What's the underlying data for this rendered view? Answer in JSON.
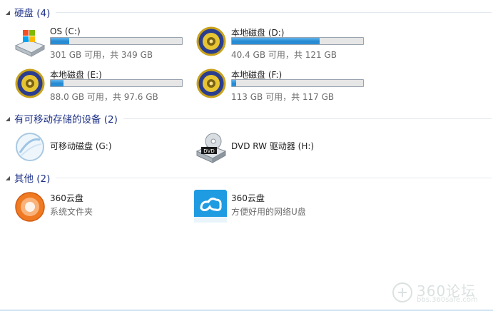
{
  "groups": [
    {
      "title": "硬盘 (4)",
      "items": [
        {
          "name": "OS (C:)",
          "usage": "301 GB 可用，共 349 GB",
          "used_fraction": 0.14,
          "icon": "windows-drive-icon"
        },
        {
          "name": "本地磁盘 (D:)",
          "usage": "40.4 GB 可用，共 121 GB",
          "used_fraction": 0.67,
          "icon": "local-disk-icon"
        },
        {
          "name": "本地磁盘 (E:)",
          "usage": "88.0 GB 可用，共 97.6 GB",
          "used_fraction": 0.1,
          "icon": "local-disk-icon"
        },
        {
          "name": "本地磁盘 (F:)",
          "usage": "113 GB 可用，共 117 GB",
          "used_fraction": 0.03,
          "icon": "local-disk-icon"
        }
      ]
    },
    {
      "title": "有可移动存储的设备 (2)",
      "items": [
        {
          "name": "可移动磁盘 (G:)",
          "icon": "removable-disk-icon"
        },
        {
          "name": "DVD RW 驱动器 (H:)",
          "icon": "dvd-drive-icon"
        }
      ]
    },
    {
      "title": "其他 (2)",
      "items": [
        {
          "name": "360云盘",
          "desc": "系统文件夹",
          "icon": "360-cloud-orange-icon"
        },
        {
          "name": "360云盘",
          "desc": "方便好用的网络U盘",
          "icon": "360-cloud-blue-icon"
        }
      ]
    }
  ],
  "watermark": {
    "line1": "360论坛",
    "line2": "bbs.360safe.com"
  },
  "colors": {
    "group_title": "#1e3287",
    "bar_fill": "#2589d2",
    "sub_text": "#6d6d6d"
  }
}
